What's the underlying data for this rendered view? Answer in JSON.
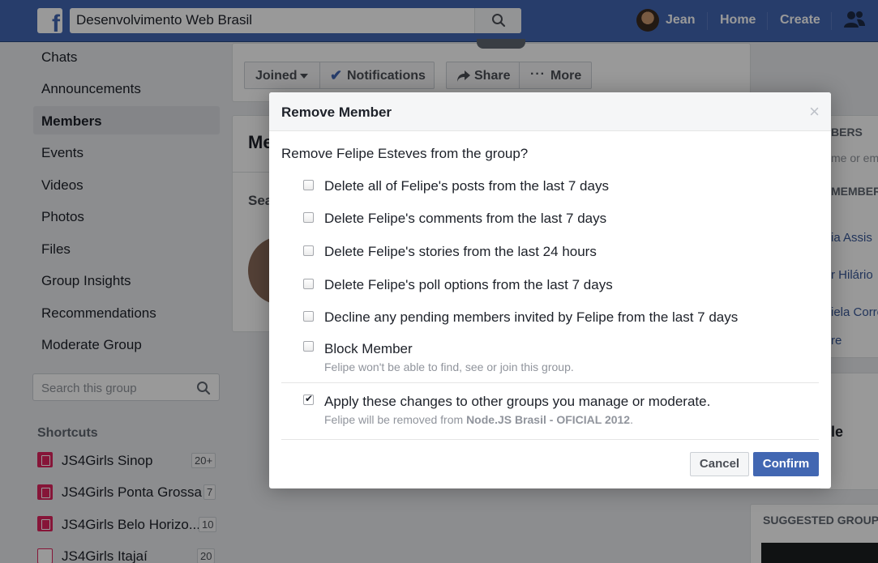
{
  "topbar": {
    "search_value": "Desenvolvimento Web Brasil",
    "user_name": "Jean",
    "home": "Home",
    "create": "Create"
  },
  "sidebar": {
    "items": [
      {
        "label": "Chats"
      },
      {
        "label": "Announcements"
      },
      {
        "label": "Members"
      },
      {
        "label": "Events"
      },
      {
        "label": "Videos"
      },
      {
        "label": "Photos"
      },
      {
        "label": "Files"
      },
      {
        "label": "Group Insights"
      },
      {
        "label": "Recommendations"
      },
      {
        "label": "Moderate Group"
      }
    ],
    "active_item": "Members",
    "search_placeholder": "Search this group",
    "shortcuts_title": "Shortcuts",
    "shortcuts": [
      {
        "label": "JS4Girls Sinop",
        "badge": "20+"
      },
      {
        "label": "JS4Girls Ponta Grossa",
        "badge": "7"
      },
      {
        "label": "JS4Girls Belo Horizo...",
        "badge": "10"
      },
      {
        "label": "JS4Girls Itajaí",
        "badge": "20"
      }
    ]
  },
  "group_actions": {
    "joined": "Joined",
    "notifications": "Notifications",
    "share": "Share",
    "more": "More"
  },
  "main": {
    "title_partial": "Me",
    "search_partial": "Sea"
  },
  "right": {
    "members_header": "BERS",
    "search_partial": "me or ema",
    "admins_header": "MEMBER",
    "names": [
      "ia Assis",
      "r Hilário",
      "iela Corre",
      "re"
    ],
    "section_partial": "le",
    "suggested_groups": "SUGGESTED GROUPS"
  },
  "modal": {
    "title": "Remove Member",
    "question": "Remove Felipe Esteves from the group?",
    "options": [
      {
        "label": "Delete all of Felipe's posts from the last 7 days",
        "checked": false
      },
      {
        "label": "Delete Felipe's comments from the last 7 days",
        "checked": false
      },
      {
        "label": "Delete Felipe's stories from the last 24 hours",
        "checked": false
      },
      {
        "label": "Delete Felipe's poll options from the last 7 days",
        "checked": false
      },
      {
        "label": "Decline any pending members invited by Felipe from the last 7 days",
        "checked": false
      },
      {
        "label": "Block Member",
        "sub": "Felipe won't be able to find, see or join this group.",
        "checked": false
      }
    ],
    "apply": {
      "label": "Apply these changes to other groups you manage or moderate.",
      "sub_prefix": "Felipe will be removed from ",
      "sub_group": "Node.JS Brasil - OFICIAL 2012",
      "sub_suffix": ".",
      "checked": true
    },
    "cancel": "Cancel",
    "confirm": "Confirm"
  }
}
